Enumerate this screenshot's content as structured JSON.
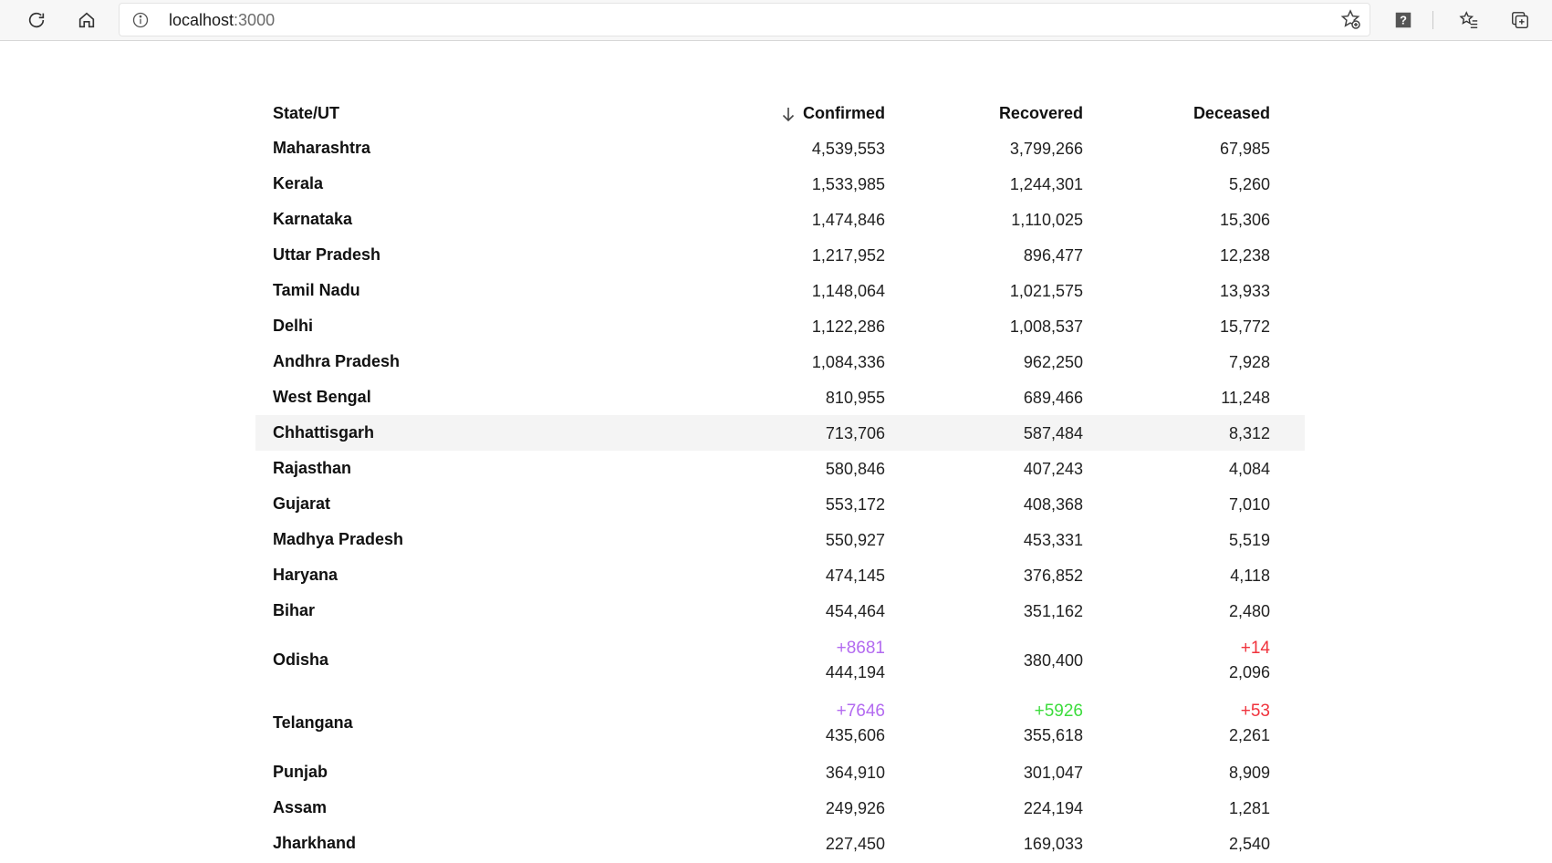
{
  "browser": {
    "url_host": "localhost",
    "url_port": ":3000"
  },
  "colors": {
    "confirmed_delta": "#b36bf0",
    "recovered_delta": "#3ddc3d",
    "deceased_delta": "#f0333d"
  },
  "table": {
    "headers": {
      "state": "State/UT",
      "confirmed": "Confirmed",
      "recovered": "Recovered",
      "deceased": "Deceased"
    },
    "sort_icon": "arrow-down-icon",
    "rows": [
      {
        "state": "Maharashtra",
        "confirmed": "4,539,553",
        "recovered": "3,799,266",
        "deceased": "67,985"
      },
      {
        "state": "Kerala",
        "confirmed": "1,533,985",
        "recovered": "1,244,301",
        "deceased": "5,260"
      },
      {
        "state": "Karnataka",
        "confirmed": "1,474,846",
        "recovered": "1,110,025",
        "deceased": "15,306"
      },
      {
        "state": "Uttar Pradesh",
        "confirmed": "1,217,952",
        "recovered": "896,477",
        "deceased": "12,238"
      },
      {
        "state": "Tamil Nadu",
        "confirmed": "1,148,064",
        "recovered": "1,021,575",
        "deceased": "13,933"
      },
      {
        "state": "Delhi",
        "confirmed": "1,122,286",
        "recovered": "1,008,537",
        "deceased": "15,772"
      },
      {
        "state": "Andhra Pradesh",
        "confirmed": "1,084,336",
        "recovered": "962,250",
        "deceased": "7,928"
      },
      {
        "state": "West Bengal",
        "confirmed": "810,955",
        "recovered": "689,466",
        "deceased": "11,248"
      },
      {
        "state": "Chhattisgarh",
        "confirmed": "713,706",
        "recovered": "587,484",
        "deceased": "8,312"
      },
      {
        "state": "Rajasthan",
        "confirmed": "580,846",
        "recovered": "407,243",
        "deceased": "4,084"
      },
      {
        "state": "Gujarat",
        "confirmed": "553,172",
        "recovered": "408,368",
        "deceased": "7,010"
      },
      {
        "state": "Madhya Pradesh",
        "confirmed": "550,927",
        "recovered": "453,331",
        "deceased": "5,519"
      },
      {
        "state": "Haryana",
        "confirmed": "474,145",
        "recovered": "376,852",
        "deceased": "4,118"
      },
      {
        "state": "Bihar",
        "confirmed": "454,464",
        "recovered": "351,162",
        "deceased": "2,480"
      },
      {
        "state": "Odisha",
        "confirmed_delta": "+8681",
        "confirmed": "444,194",
        "recovered": "380,400",
        "deceased_delta": "+14",
        "deceased": "2,096"
      },
      {
        "state": "Telangana",
        "confirmed_delta": "+7646",
        "confirmed": "435,606",
        "recovered_delta": "+5926",
        "recovered": "355,618",
        "deceased_delta": "+53",
        "deceased": "2,261"
      },
      {
        "state": "Punjab",
        "confirmed": "364,910",
        "recovered": "301,047",
        "deceased": "8,909"
      },
      {
        "state": "Assam",
        "confirmed": "249,926",
        "recovered": "224,194",
        "deceased": "1,281"
      },
      {
        "state": "Jharkhand",
        "confirmed": "227,450",
        "recovered": "169,033",
        "deceased": "2,540"
      }
    ]
  }
}
